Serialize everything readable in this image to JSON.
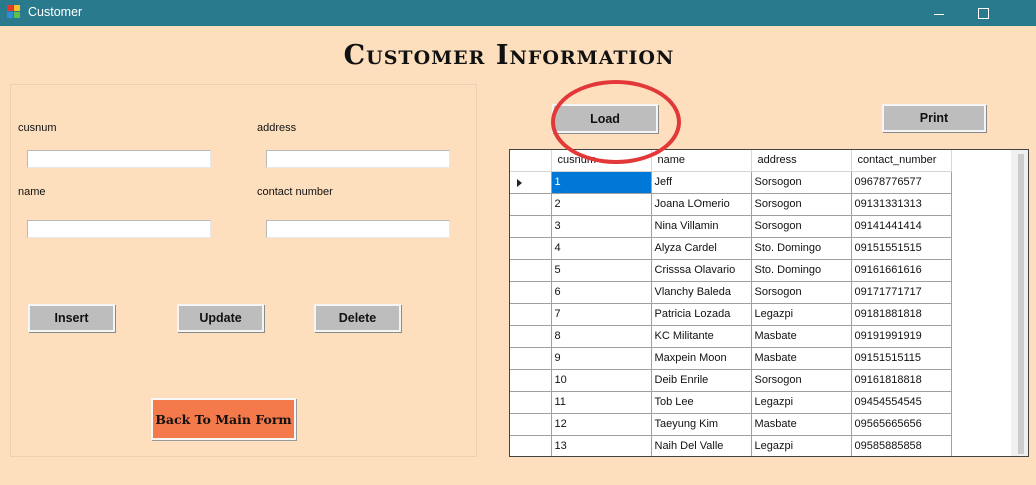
{
  "window": {
    "title": "Customer"
  },
  "header": {
    "title": "Customer Information"
  },
  "form": {
    "cusnum_label": "cusnum",
    "address_label": "address",
    "name_label": "name",
    "contact_label": "contact number",
    "cusnum_value": "",
    "address_value": "",
    "name_value": "",
    "contact_value": ""
  },
  "buttons": {
    "insert": "Insert",
    "update": "Update",
    "delete": "Delete",
    "back": "Back To Main Form",
    "load": "Load",
    "print": "Print"
  },
  "colors": {
    "background": "#fddfbe",
    "titlebar": "#2a7a8e",
    "back_button": "#f47a4c",
    "selection": "#0078d7",
    "annotation_circle": "#e33838"
  },
  "table": {
    "columns": [
      "cusnum",
      "name",
      "address",
      "contact_number"
    ],
    "selected_row": 0,
    "rows": [
      [
        "1",
        "Jeff",
        "Sorsogon",
        "09678776577"
      ],
      [
        "2",
        "Joana LOmerio",
        "Sorsogon",
        "09131331313"
      ],
      [
        "3",
        "Nina Villamin",
        "Sorsogon",
        "09141441414"
      ],
      [
        "4",
        "Alyza Cardel",
        "Sto. Domingo",
        "09151551515"
      ],
      [
        "5",
        "Crisssa Olavario",
        "Sto. Domingo",
        "09161661616"
      ],
      [
        "6",
        "Vlanchy Baleda",
        "Sorsogon",
        "09171771717"
      ],
      [
        "7",
        "Patricia Lozada",
        "Legazpi",
        "09181881818"
      ],
      [
        "8",
        "KC Militante",
        "Masbate",
        "09191991919"
      ],
      [
        "9",
        "Maxpein Moon",
        "Masbate",
        "09151515115"
      ],
      [
        "10",
        "Deib Enrile",
        "Sorsogon",
        "09161818818"
      ],
      [
        "11",
        "Tob Lee",
        "Legazpi",
        "09454554545"
      ],
      [
        "12",
        "Taeyung Kim",
        "Masbate",
        "09565665656"
      ],
      [
        "13",
        "Naih Del Valle",
        "Legazpi",
        "09585885858"
      ]
    ]
  }
}
